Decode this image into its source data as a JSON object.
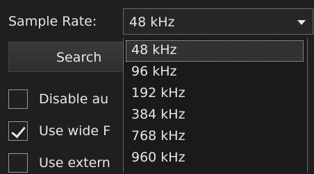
{
  "sample_rate": {
    "label": "Sample Rate:",
    "selected": "48 kHz",
    "options": [
      "48 kHz",
      "96 kHz",
      "192 kHz",
      "384 kHz",
      "768 kHz",
      "960 kHz"
    ]
  },
  "buttons": {
    "search": "Search"
  },
  "checkboxes": [
    {
      "label": "Disable au",
      "checked": false
    },
    {
      "label": "Use wide F",
      "checked": true
    },
    {
      "label": "Use extern",
      "checked": false
    }
  ]
}
